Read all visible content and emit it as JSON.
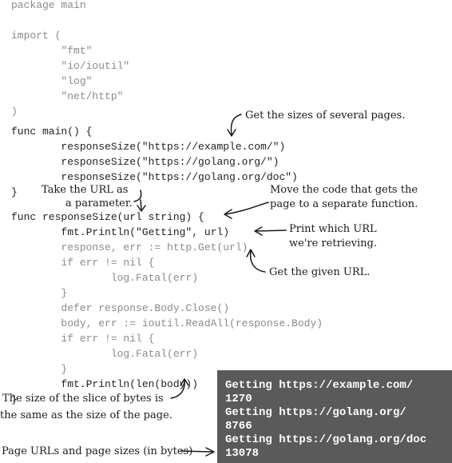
{
  "code_lines": [
    "package main",
    "",
    "import (",
    "        \"fmt\"",
    "        \"io/ioutil\"",
    "        \"log\"",
    "        \"net/http\"",
    ")",
    "",
    "func main() {",
    "        responseSize(\"https://example.com/\")",
    "        responseSize(\"https://golang.org/\")",
    "        responseSize(\"https://golang.org/doc\")",
    "}",
    "func responseSize(url string) {",
    "        fmt.Println(\"Getting\", url)",
    "        response, err := http.Get(url)",
    "        if err != nil {",
    "                log.Fatal(err)",
    "        }",
    "        defer response.Body.Close()",
    "        body, err := ioutil.ReadAll(response.Body)",
    "        if err != nil {",
    "                log.Fatal(err)",
    "        }",
    "        fmt.Println(len(body))",
    "}"
  ],
  "notes": {
    "get_sizes": "Get the sizes of several pages.",
    "take_url_1": "Take the URL as",
    "take_url_2": "a parameter.",
    "move_code_1": "Move the code that gets the",
    "move_code_2": "page to a separate function.",
    "print_url_1": "Print which URL",
    "print_url_2": "we're retrieving.",
    "get_given": "Get the given URL.",
    "slice_1": "The size of the slice of bytes is",
    "slice_2": "the same as the size of the page.",
    "page_urls": "Page URLs and page sizes (in bytes)"
  },
  "terminal_lines": [
    "Getting https://example.com/",
    "1270",
    "Getting https://golang.org/",
    "8766",
    "Getting https://golang.org/doc",
    "13078"
  ],
  "colors": {
    "code_dark": "#1f1f1f",
    "code_light": "#8a8a8a",
    "terminal_bg": "#5a5a5a",
    "terminal_text": "#ffffff"
  }
}
